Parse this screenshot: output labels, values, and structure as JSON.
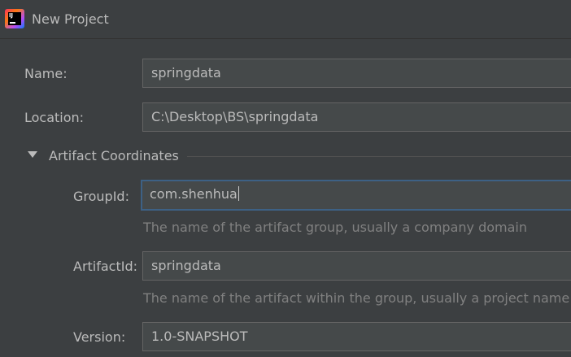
{
  "window": {
    "title": "New Project",
    "icon": "intellij-idea-icon"
  },
  "form": {
    "name": {
      "label": "Name:",
      "value": "springdata"
    },
    "location": {
      "label": "Location:",
      "value": "C:\\Desktop\\BS\\springdata"
    }
  },
  "artifact": {
    "section_label": "Artifact Coordinates",
    "expanded": true,
    "group_id": {
      "label": "GroupId:",
      "value": "com.shenhua",
      "hint": "The name of the artifact group, usually a company domain"
    },
    "artifact_id": {
      "label": "ArtifactId:",
      "value": "springdata",
      "hint": "The name of the artifact within the group, usually a project name"
    },
    "version": {
      "label": "Version:",
      "value": "1.0-SNAPSHOT"
    }
  },
  "colors": {
    "background": "#3c3f41",
    "field_background": "#45494a",
    "focus_border": "#3d6185",
    "hint_text": "#808080"
  }
}
